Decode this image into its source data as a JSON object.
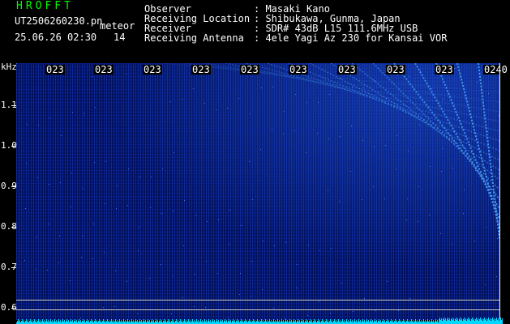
{
  "header": {
    "title": "HROFFT",
    "filename": "UT2506260230.pn",
    "label": "meteor",
    "datetime": "25.06.26 02:30",
    "count": "14",
    "observer_key": "Observer",
    "observer_value": ": Masaki Kano",
    "location_key": "Receiving Location",
    "location_value": ": Shibukawa, Gunma, Japan",
    "receiver_key": "Receiver",
    "receiver_value": ": SDR# 43dB L15 111.6MHz USB",
    "antenna_key": "Receiving Antenna",
    "antenna_value": ": 4ele Yagi Az 230 for Kansai VOR"
  },
  "axis": {
    "unit": "kHz",
    "ticks": [
      "1.1",
      "1.0",
      "0.9",
      "0.8",
      "0.7",
      "0.6"
    ]
  },
  "time_labels": [
    "023",
    "023",
    "023",
    "023",
    "023",
    "023",
    "023",
    "023",
    "023",
    "0240"
  ],
  "colors": {
    "background": "#000000",
    "title": "#00ff00",
    "text": "#ffffff",
    "noise": "#00105a",
    "streak": "#4aa8ff",
    "signal": "#00d8ff"
  }
}
